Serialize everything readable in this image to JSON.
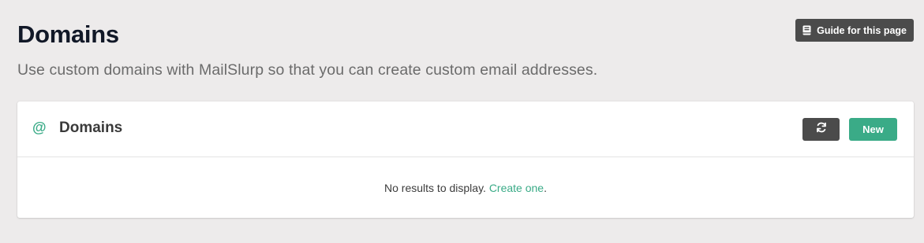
{
  "page": {
    "title": "Domains",
    "subtitle": "Use custom domains with MailSlurp so that you can create custom email addresses.",
    "guide_button_label": "Guide for this page",
    "guide_icon": "book-icon"
  },
  "card": {
    "icon_glyph": "@",
    "title": "Domains",
    "refresh_icon": "refresh-icon",
    "new_button_label": "New",
    "empty_text": "No results to display.",
    "empty_link_text": "Create one",
    "empty_suffix": "."
  },
  "colors": {
    "background": "#edebeb",
    "accent": "#3aab87",
    "dark_button": "#4b4b4b",
    "card": "#ffffff"
  }
}
